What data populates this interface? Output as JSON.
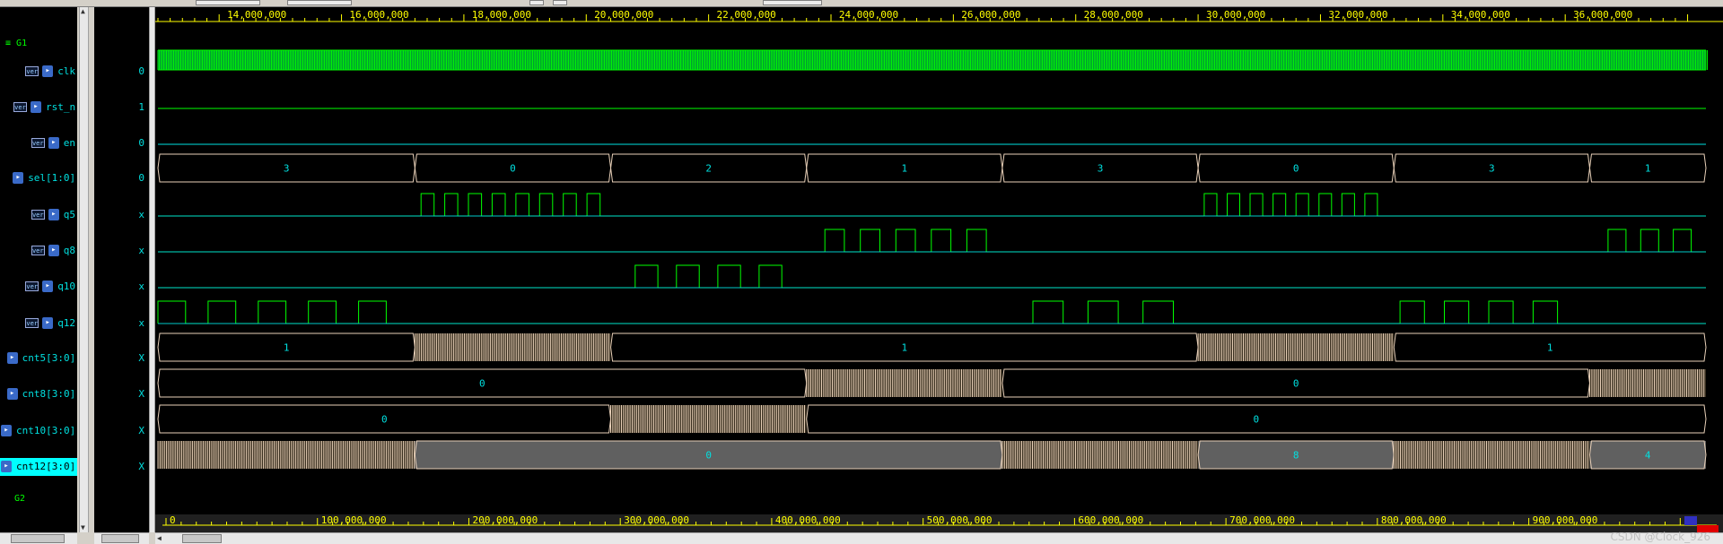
{
  "signals": [
    {
      "name": "clk",
      "badge": "ver",
      "value": "0",
      "type": "clock"
    },
    {
      "name": "rst_n",
      "badge": "ver",
      "value": "1",
      "type": "bit"
    },
    {
      "name": "en",
      "badge": "ver",
      "value": "0",
      "type": "bit"
    },
    {
      "name": "sel[1:0]",
      "badge": "",
      "value": "0",
      "type": "bus"
    },
    {
      "name": "q5",
      "badge": "ver",
      "value": "x",
      "type": "bit"
    },
    {
      "name": "q8",
      "badge": "ver",
      "value": "x",
      "type": "bit"
    },
    {
      "name": "q10",
      "badge": "ver",
      "value": "x",
      "type": "bit"
    },
    {
      "name": "q12",
      "badge": "ver",
      "value": "x",
      "type": "bit"
    },
    {
      "name": "cnt5[3:0]",
      "badge": "",
      "value": "X",
      "type": "bus"
    },
    {
      "name": "cnt8[3:0]",
      "badge": "",
      "value": "X",
      "type": "bus"
    },
    {
      "name": "cnt10[3:0]",
      "badge": "",
      "value": "X",
      "type": "bus"
    },
    {
      "name": "cnt12[3:0]",
      "badge": "",
      "value": "X",
      "type": "bus"
    }
  ],
  "groups": {
    "g1": "G1",
    "g2": "G2"
  },
  "watermark": "CSDN @Clock_926",
  "colors": {
    "background": "#000000",
    "clock": "#00c0a8",
    "wave_high": "#00ff00",
    "wave_low": "#00e0e0",
    "bus": "#e8d0b8",
    "bus_text": "#00e0e0",
    "ruler_text": "#ffff00",
    "selected": "#00ffff",
    "shaded_bus": "#606060"
  },
  "chart_data": {
    "type": "waveform",
    "top_axis": {
      "ticks": [
        "14,000,000",
        "16,000,000",
        "18,000,000",
        "20,000,000",
        "22,000,000",
        "24,000,000",
        "26,000,000",
        "28,000,000",
        "30,000,000",
        "32,000,000",
        "34,000,000",
        "36,000,000"
      ],
      "values": [
        14000000,
        16000000,
        18000000,
        20000000,
        22000000,
        24000000,
        26000000,
        28000000,
        30000000,
        32000000,
        34000000,
        36000000
      ],
      "range": [
        13000000,
        38300000
      ]
    },
    "bottom_axis": {
      "ticks": [
        "0",
        "100,000,000",
        "200,000,000",
        "300,000,000",
        "400,000,000",
        "500,000,000",
        "600,000,000",
        "700,000,000",
        "800,000,000",
        "900,000,000"
      ],
      "values": [
        0,
        100000000,
        200000000,
        300000000,
        400000000,
        500000000,
        600000000,
        700000000,
        800000000,
        900000000
      ],
      "range": [
        0,
        1017000000
      ]
    },
    "traces": {
      "rst_n": {
        "level": 1
      },
      "en": {
        "level": 0
      },
      "sel": {
        "segments": [
          {
            "start": 13000000,
            "end": 17200000,
            "label": "3"
          },
          {
            "start": 17200000,
            "end": 20400000,
            "label": "0"
          },
          {
            "start": 20400000,
            "end": 23600000,
            "label": "2"
          },
          {
            "start": 23600000,
            "end": 26800000,
            "label": "1"
          },
          {
            "start": 26800000,
            "end": 30000000,
            "label": "3"
          },
          {
            "start": 30000000,
            "end": 33200000,
            "label": "0"
          },
          {
            "start": 33200000,
            "end": 36400000,
            "label": "3"
          },
          {
            "start": 36400000,
            "end": 38300000,
            "label": "1"
          }
        ]
      },
      "q5": {
        "windows": [
          [
            17300000,
            20400000,
            8
          ],
          [
            30100000,
            33100000,
            8
          ]
        ]
      },
      "q8": {
        "windows": [
          [
            23900000,
            26800000,
            5
          ],
          [
            36700000,
            38300000,
            3
          ]
        ]
      },
      "q10": {
        "windows": [
          [
            20800000,
            23500000,
            4
          ]
        ]
      },
      "q12": {
        "windows": [
          [
            13000000,
            17100000,
            5
          ],
          [
            27300000,
            30000000,
            3
          ],
          [
            33300000,
            36200000,
            4
          ]
        ]
      },
      "cnt5": {
        "segments": [
          {
            "start": 13000000,
            "end": 17200000,
            "label": "1"
          },
          {
            "start": 17200000,
            "end": 20400000,
            "dense": true
          },
          {
            "start": 20400000,
            "end": 30000000,
            "label": "1"
          },
          {
            "start": 30000000,
            "end": 33200000,
            "dense": true
          },
          {
            "start": 33200000,
            "end": 38300000,
            "label": "1"
          }
        ]
      },
      "cnt8": {
        "segments": [
          {
            "start": 13000000,
            "end": 23600000,
            "label": "0"
          },
          {
            "start": 23600000,
            "end": 26800000,
            "dense": true
          },
          {
            "start": 26800000,
            "end": 36400000,
            "label": "0"
          },
          {
            "start": 36400000,
            "end": 38300000,
            "dense": true
          }
        ]
      },
      "cnt10": {
        "segments": [
          {
            "start": 13000000,
            "end": 20400000,
            "label": "0"
          },
          {
            "start": 20400000,
            "end": 23600000,
            "dense": true
          },
          {
            "start": 23600000,
            "end": 38300000,
            "label": "0"
          }
        ]
      },
      "cnt12": {
        "segments": [
          {
            "start": 13000000,
            "end": 17200000,
            "dense": true
          },
          {
            "start": 17200000,
            "end": 26800000,
            "label": "0",
            "shaded": true
          },
          {
            "start": 26800000,
            "end": 30000000,
            "dense": true
          },
          {
            "start": 30000000,
            "end": 33200000,
            "label": "8",
            "shaded": true
          },
          {
            "start": 33200000,
            "end": 36400000,
            "dense": true
          },
          {
            "start": 36400000,
            "end": 38300000,
            "label": "4",
            "shaded": true
          }
        ]
      }
    }
  }
}
